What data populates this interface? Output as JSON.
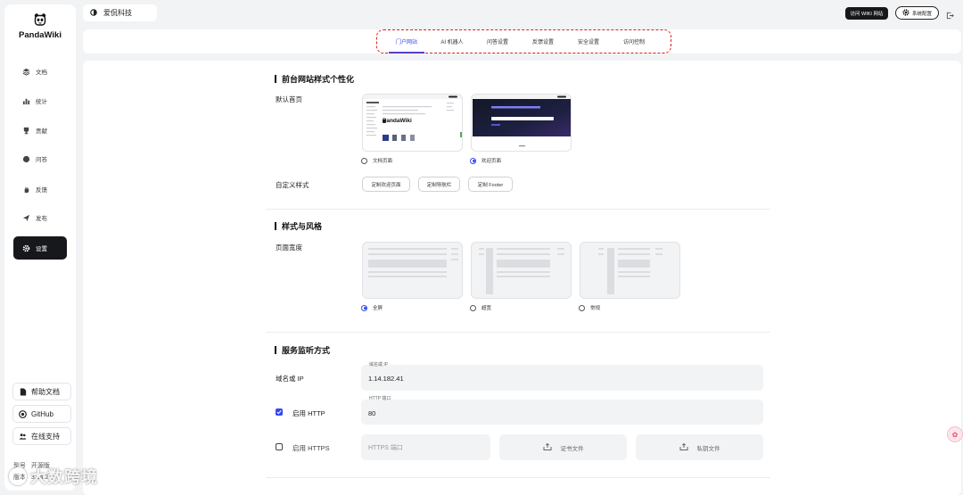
{
  "app": {
    "name": "PandaWiki"
  },
  "sidebar": {
    "items": [
      {
        "label": "文档",
        "icon": "layers-icon"
      },
      {
        "label": "统计",
        "icon": "bar-chart-icon"
      },
      {
        "label": "贡献",
        "icon": "trophy-icon"
      },
      {
        "label": "问答",
        "icon": "chat-icon"
      },
      {
        "label": "反馈",
        "icon": "hand-icon"
      },
      {
        "label": "发布",
        "icon": "send-icon"
      },
      {
        "label": "设置",
        "icon": "gear-icon",
        "active": true
      }
    ],
    "bottom_buttons": [
      {
        "label": "帮助文档",
        "icon": "document-icon"
      },
      {
        "label": "GitHub",
        "icon": "github-icon"
      },
      {
        "label": "在线支持",
        "icon": "people-icon"
      }
    ],
    "footer": {
      "edition_label": "型号",
      "edition_value": "开源版",
      "version_label": "版本",
      "version_value": "3.34.2"
    }
  },
  "header": {
    "kb_name": "爱侃科技",
    "visit_wiki": "访问 WIKI 网站",
    "system_config": "系统配置"
  },
  "tabs": [
    {
      "label": "门户网站",
      "active": true
    },
    {
      "label": "AI 机器人"
    },
    {
      "label": "问答设置"
    },
    {
      "label": "反馈设置"
    },
    {
      "label": "安全设置"
    },
    {
      "label": "访问控制"
    }
  ],
  "portal": {
    "title": "前台网站样式个性化",
    "default_home_label": "默认首页",
    "home_options": [
      {
        "label": "文档页面",
        "selected": false,
        "preview_title": "PandaWiki"
      },
      {
        "label": "欢迎页面",
        "selected": true
      }
    ],
    "custom_style_label": "自定义样式",
    "custom_buttons": [
      "定制欢迎页面",
      "定制导航栏",
      "定制 Footer"
    ]
  },
  "style": {
    "title": "样式与风格",
    "page_width_label": "页面宽度",
    "width_options": [
      {
        "label": "全屏",
        "selected": true
      },
      {
        "label": "超宽",
        "selected": false
      },
      {
        "label": "常规",
        "selected": false
      }
    ]
  },
  "listen": {
    "title": "服务监听方式",
    "domain_label": "域名或 IP",
    "domain_field_label": "域名或 IP",
    "domain_value": "1.14.182.41",
    "http_label": "启用 HTTP",
    "http_enabled": true,
    "http_port_label": "HTTP 端口",
    "http_port_value": "80",
    "https_label": "启用 HTTPS",
    "https_enabled": false,
    "https_port_placeholder": "HTTPS 端口",
    "cert_file": "证书文件",
    "key_file": "私钥文件"
  },
  "watermark": "大数跨境",
  "colors": {
    "accent": "#3248f2",
    "dark": "#17181c",
    "highlight_outline": "#e02020"
  }
}
